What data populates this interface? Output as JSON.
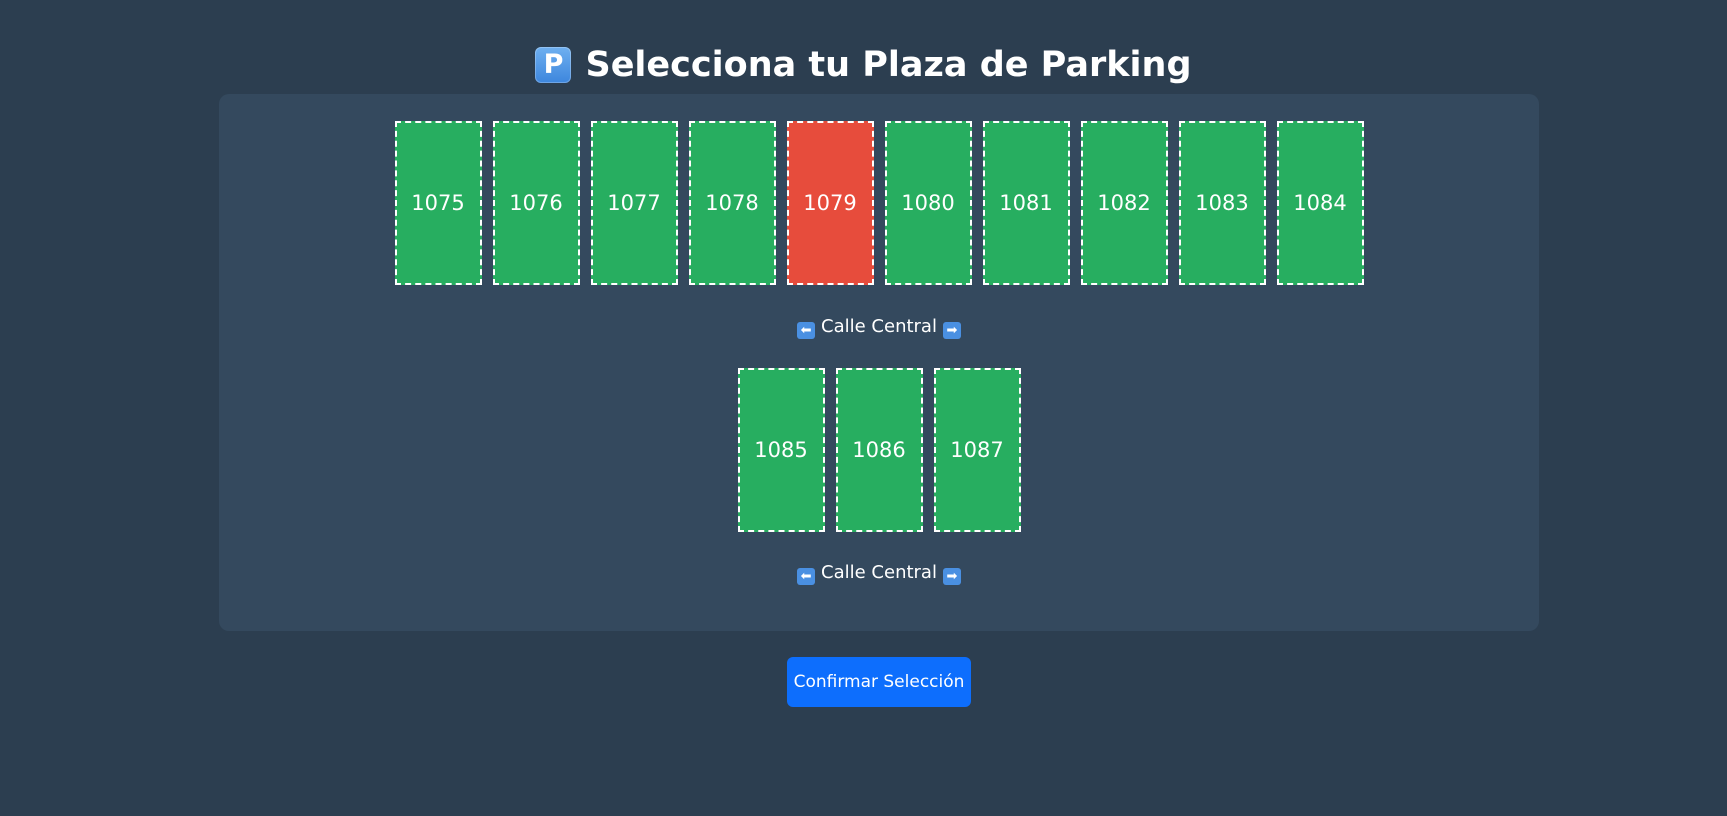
{
  "header": {
    "icon_glyph": "P",
    "icon_name": "parking-icon",
    "title": "Selecciona tu Plaza de Parking"
  },
  "lot": {
    "rows": [
      {
        "spots": [
          {
            "number": "1075",
            "status": "free"
          },
          {
            "number": "1076",
            "status": "free"
          },
          {
            "number": "1077",
            "status": "free"
          },
          {
            "number": "1078",
            "status": "free"
          },
          {
            "number": "1079",
            "status": "occupied"
          },
          {
            "number": "1080",
            "status": "free"
          },
          {
            "number": "1081",
            "status": "free"
          },
          {
            "number": "1082",
            "status": "free"
          },
          {
            "number": "1083",
            "status": "free"
          },
          {
            "number": "1084",
            "status": "free"
          }
        ],
        "street": "Calle Central"
      },
      {
        "spots": [
          {
            "number": "1085",
            "status": "free"
          },
          {
            "number": "1086",
            "status": "free"
          },
          {
            "number": "1087",
            "status": "free"
          }
        ],
        "street": "Calle Central"
      }
    ],
    "street_left_glyph": "⬅",
    "street_right_glyph": "➡"
  },
  "actions": {
    "confirm_label": "Confirmar Selección"
  },
  "colors": {
    "background": "#2c3e50",
    "panel": "#34495e",
    "free": "#27ae60",
    "occupied": "#e74c3c",
    "primary": "#0d6efd"
  }
}
